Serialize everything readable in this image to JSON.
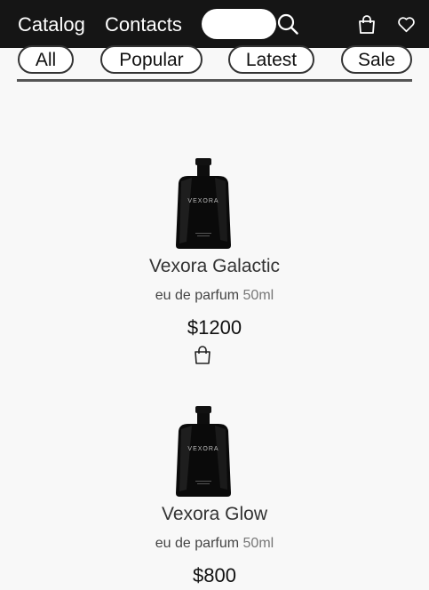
{
  "header": {
    "nav": [
      "Catalog",
      "Contacts"
    ],
    "search_placeholder": "",
    "search_icon": "search-icon",
    "cart_icon": "shopping-bag-icon",
    "wishlist_icon": "heart-icon"
  },
  "filters": [
    "All",
    "Popular",
    "Latest",
    "Sale"
  ],
  "products": [
    {
      "bottle_label": "VEXORA",
      "name": "Vexora Galactic",
      "type": "eu de parfum",
      "volume": "50ml",
      "price": "$1200"
    },
    {
      "bottle_label": "VEXORA",
      "name": "Vexora Glow",
      "type": "eu de parfum",
      "volume": "50ml",
      "price": "$800"
    }
  ],
  "colors": {
    "header_bg": "#151515",
    "page_bg": "#f8f8f8",
    "pill_border": "#333333"
  }
}
